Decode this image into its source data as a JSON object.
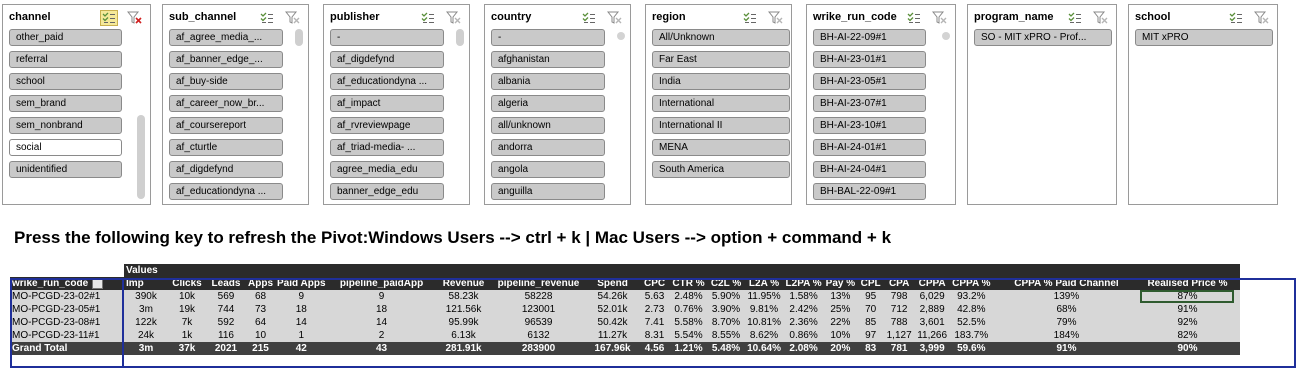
{
  "slicers": [
    {
      "title": "channel",
      "multi_active": true,
      "items": [
        {
          "label": "other_paid",
          "selected": true
        },
        {
          "label": "referral",
          "selected": true
        },
        {
          "label": "school",
          "selected": true
        },
        {
          "label": "sem_brand",
          "selected": true
        },
        {
          "label": "sem_nonbrand",
          "selected": true
        },
        {
          "label": "social",
          "selected": false
        },
        {
          "label": "unidentified",
          "selected": true
        }
      ]
    },
    {
      "title": "sub_channel",
      "multi_active": false,
      "items": [
        {
          "label": "af_agree_media_...",
          "selected": true
        },
        {
          "label": "af_banner_edge_...",
          "selected": true
        },
        {
          "label": "af_buy-side",
          "selected": true
        },
        {
          "label": "af_career_now_br...",
          "selected": true
        },
        {
          "label": "af_coursereport",
          "selected": true
        },
        {
          "label": "af_cturtle",
          "selected": true
        },
        {
          "label": "af_digdefynd",
          "selected": true
        },
        {
          "label": "af_educationdyna ...",
          "selected": true
        }
      ]
    },
    {
      "title": "publisher",
      "multi_active": false,
      "items": [
        {
          "label": "-",
          "selected": true
        },
        {
          "label": "af_digdefynd",
          "selected": true
        },
        {
          "label": "af_educationdyna ...",
          "selected": true
        },
        {
          "label": "af_impact",
          "selected": true
        },
        {
          "label": "af_rvreviewpage",
          "selected": true
        },
        {
          "label": "af_triad-media- ...",
          "selected": true
        },
        {
          "label": "agree_media_edu",
          "selected": true
        },
        {
          "label": "banner_edge_edu",
          "selected": true
        }
      ]
    },
    {
      "title": "country",
      "multi_active": false,
      "items": [
        {
          "label": "-",
          "selected": true
        },
        {
          "label": "afghanistan",
          "selected": true
        },
        {
          "label": "albania",
          "selected": true
        },
        {
          "label": "algeria",
          "selected": true
        },
        {
          "label": "all/unknown",
          "selected": true
        },
        {
          "label": "andorra",
          "selected": true
        },
        {
          "label": "angola",
          "selected": true
        },
        {
          "label": "anguilla",
          "selected": true
        }
      ]
    },
    {
      "title": "region",
      "multi_active": false,
      "items": [
        {
          "label": "All/Unknown",
          "selected": true
        },
        {
          "label": "Far East",
          "selected": true
        },
        {
          "label": "India",
          "selected": true
        },
        {
          "label": "International",
          "selected": true
        },
        {
          "label": "International II",
          "selected": true
        },
        {
          "label": "MENA",
          "selected": true
        },
        {
          "label": "South America",
          "selected": true
        }
      ]
    },
    {
      "title": "wrike_run_code",
      "multi_active": false,
      "items": [
        {
          "label": "BH-AI-22-09#1",
          "selected": true
        },
        {
          "label": "BH-AI-23-01#1",
          "selected": true
        },
        {
          "label": "BH-AI-23-05#1",
          "selected": true
        },
        {
          "label": "BH-AI-23-07#1",
          "selected": true
        },
        {
          "label": "BH-AI-23-10#1",
          "selected": true
        },
        {
          "label": "BH-AI-24-01#1",
          "selected": true
        },
        {
          "label": "BH-AI-24-04#1",
          "selected": true
        },
        {
          "label": "BH-BAL-22-09#1",
          "selected": true
        }
      ]
    },
    {
      "title": "program_name",
      "multi_active": false,
      "items": [
        {
          "label": "SO - MIT xPRO - Prof...",
          "selected": true
        }
      ]
    },
    {
      "title": "school",
      "multi_active": false,
      "items": [
        {
          "label": "MIT xPRO",
          "selected": true
        }
      ]
    }
  ],
  "instruction": "Press the following key to refresh the Pivot:Windows Users --> ctrl + k | Mac Users --> option + command + k",
  "pivot": {
    "values_label": "Values",
    "row_header": "wrike_run_code",
    "columns": [
      "Imp",
      "Clicks",
      "Leads",
      "Apps",
      "Paid Apps",
      "pipeline_paidApp",
      "Revenue",
      "pipeline_revenue",
      "Spend",
      "CPC",
      "CTR %",
      "C2L %",
      "L2A %",
      "L2PA %",
      "Pay %",
      "CPL",
      "CPA",
      "CPPA",
      "CPPA %",
      "CPPA % Paid Channel",
      "Realised Price %"
    ],
    "rows": [
      {
        "key": "MO-PCGD-23-02#1",
        "cells": [
          "390k",
          "10k",
          "569",
          "68",
          "9",
          "9",
          "58.23k",
          "58228",
          "54.26k",
          "5.63",
          "2.48%",
          "5.90%",
          "11.95%",
          "1.58%",
          "13%",
          "95",
          "798",
          "6,029",
          "93.2%",
          "139%",
          "87%"
        ]
      },
      {
        "key": "MO-PCGD-23-05#1",
        "cells": [
          "3m",
          "19k",
          "744",
          "73",
          "18",
          "18",
          "121.56k",
          "123001",
          "52.01k",
          "2.73",
          "0.76%",
          "3.90%",
          "9.81%",
          "2.42%",
          "25%",
          "70",
          "712",
          "2,889",
          "42.8%",
          "68%",
          "91%"
        ]
      },
      {
        "key": "MO-PCGD-23-08#1",
        "cells": [
          "122k",
          "7k",
          "592",
          "64",
          "14",
          "14",
          "95.99k",
          "96539",
          "50.42k",
          "7.41",
          "5.58%",
          "8.70%",
          "10.81%",
          "2.36%",
          "22%",
          "85",
          "788",
          "3,601",
          "52.5%",
          "79%",
          "92%"
        ]
      },
      {
        "key": "MO-PCGD-23-11#1",
        "cells": [
          "24k",
          "1k",
          "116",
          "10",
          "1",
          "2",
          "6.13k",
          "6132",
          "11.27k",
          "8.31",
          "5.54%",
          "8.55%",
          "8.62%",
          "0.86%",
          "10%",
          "97",
          "1,127",
          "11,266",
          "183.7%",
          "184%",
          "82%"
        ]
      }
    ],
    "total": {
      "key": "Grand Total",
      "cells": [
        "3m",
        "37k",
        "2021",
        "215",
        "42",
        "43",
        "281.91k",
        "283900",
        "167.96k",
        "4.56",
        "1.21%",
        "5.48%",
        "10.64%",
        "2.08%",
        "20%",
        "83",
        "781",
        "3,999",
        "59.6%",
        "91%",
        "90%"
      ]
    }
  },
  "colors": {
    "selected_item": "#c9c9c9",
    "header_dark": "#2b2b2b",
    "row_bg": "#d7d7d7",
    "total_bg": "#404040",
    "pivot_border": "#1f2f9a",
    "active_multi": "#f5e99a"
  }
}
